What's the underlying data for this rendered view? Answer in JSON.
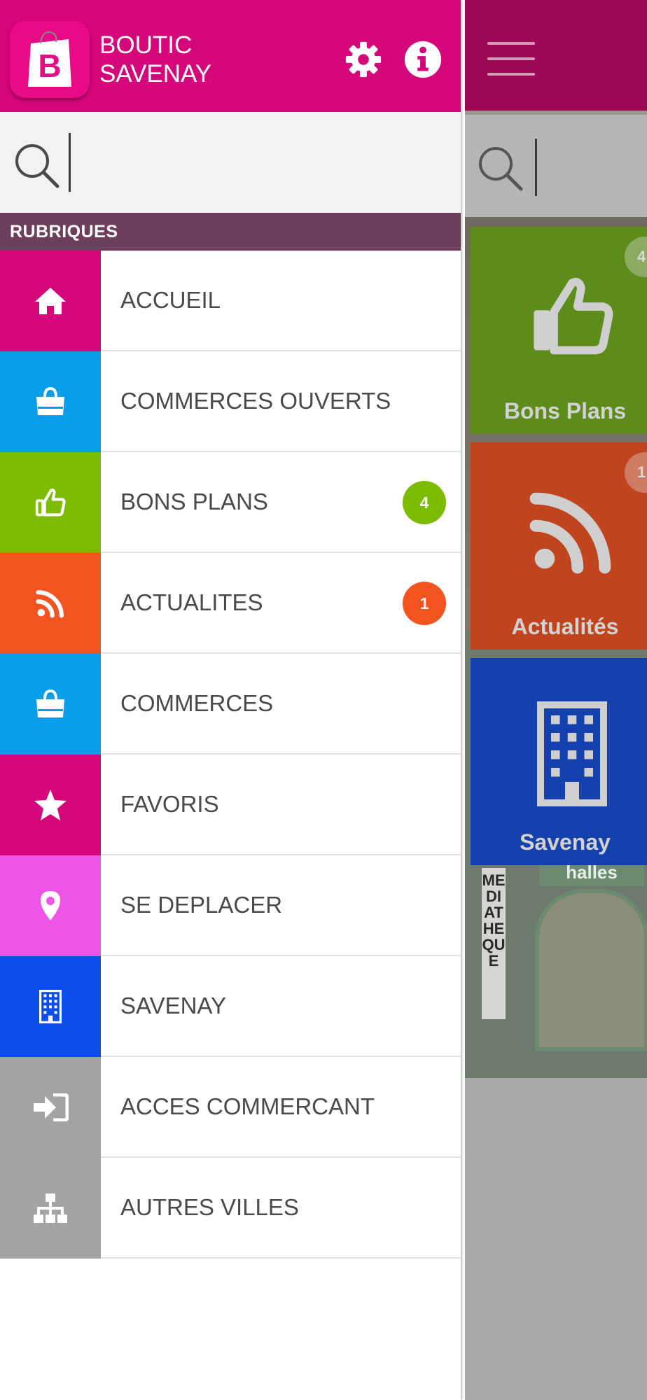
{
  "app": {
    "title": "BOUTIC\nSAVENAY",
    "title_line1": "BOUTIC",
    "title_line2": "SAVENAY",
    "logo_letter": "B"
  },
  "header": {
    "settings_icon": "gear-icon",
    "info_icon": "info-icon"
  },
  "search": {
    "value": "",
    "placeholder": "",
    "icon": "search-icon"
  },
  "section": {
    "title": "RUBRIQUES"
  },
  "colors": {
    "brand": "#d5057a",
    "section_bar": "#6e3f5b",
    "badge_green": "#7dbb00",
    "badge_orange": "#f2531f"
  },
  "menu": [
    {
      "label": "ACCUEIL",
      "icon": "home-icon",
      "color": "#d5057a"
    },
    {
      "label": "COMMERCES OUVERTS",
      "icon": "shopping-bag-icon",
      "color": "#0a9de9"
    },
    {
      "label": "BONS PLANS",
      "icon": "thumbs-up-icon",
      "color": "#7dbb00",
      "badge": "4",
      "badge_color": "#7dbb00"
    },
    {
      "label": "ACTUALITES",
      "icon": "rss-icon",
      "color": "#f2531f",
      "badge": "1",
      "badge_color": "#f2531f"
    },
    {
      "label": "COMMERCES",
      "icon": "shopping-bag-icon",
      "color": "#0a9de9"
    },
    {
      "label": "FAVORIS",
      "icon": "star-icon",
      "color": "#d5057a"
    },
    {
      "label": "SE DEPLACER",
      "icon": "map-pin-icon",
      "color": "#ee55e6"
    },
    {
      "label": "SAVENAY",
      "icon": "building-icon",
      "color": "#0a4de9"
    },
    {
      "label": "ACCES COMMERCANT",
      "icon": "sign-in-icon",
      "color": "#a3a3a3"
    },
    {
      "label": "AUTRES VILLES",
      "icon": "sitemap-icon",
      "color": "#a3a3a3"
    }
  ],
  "background": {
    "menu_icon": "hamburger-icon",
    "tiles": [
      {
        "label": "Bons Plans",
        "badge": "4",
        "icon": "thumbs-up-icon",
        "color": "#5d8c1a"
      },
      {
        "label": "Actualités",
        "badge": "1",
        "icon": "rss-icon",
        "color": "#c0441d"
      },
      {
        "label": "Savenay",
        "icon": "building-icon",
        "color": "#1441ad"
      }
    ],
    "photo_signs": {
      "halles": "halles",
      "mediatheque": "MEDIATHEQUE"
    }
  }
}
